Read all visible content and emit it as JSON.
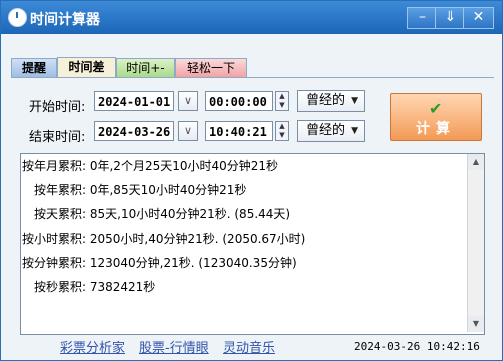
{
  "window": {
    "title": "时间计算器"
  },
  "titlebar": {
    "min": "–",
    "options": "⇓",
    "close": "✕"
  },
  "tabs": [
    "提醒",
    "时间差",
    "时间+-",
    "轻松一下"
  ],
  "form": {
    "start_label": "开始时间:",
    "end_label": "结束时间:",
    "start_date": "2024-01-01",
    "end_date": "2024-03-26",
    "start_time": "00:00:00",
    "end_time": "10:40:21",
    "start_mode": "曾经的",
    "end_mode": "曾经的",
    "calc_label": "计算"
  },
  "results": [
    "按年月累积: 0年,2个月25天10小时40分钟21秒",
    "按年累积: 0年,85天10小时40分钟21秒",
    "按天累积: 85天,10小时40分钟21秒. (85.44天)",
    "按小时累积: 2050小时,40分钟21秒. (2050.67小时)",
    "按分钟累积: 123040分钟,21秒. (123040.35分钟)",
    "按秒累积: 7382421秒"
  ],
  "footer": {
    "links": [
      "彩票分析家",
      "股票-行情眼",
      "灵动音乐"
    ],
    "datetime": "2024-03-26 10:42:16"
  },
  "icons": {
    "check": "check-icon",
    "dropdown": "chevron-down-icon",
    "clock": "clock-icon"
  }
}
